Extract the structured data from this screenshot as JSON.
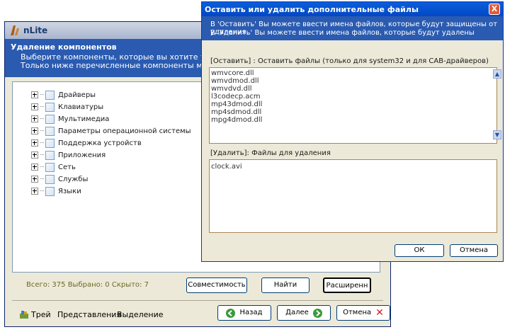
{
  "app": {
    "title": "nLite",
    "header_title": "Удаление компонентов",
    "header_line1": "Выберите компоненты, которые вы хотите удалить из у",
    "header_line2": "Только ниже перечисленные компоненты могут быть у"
  },
  "tree": {
    "items": [
      {
        "label": "Драйверы"
      },
      {
        "label": "Клавиатуры"
      },
      {
        "label": "Мультимедиа"
      },
      {
        "label": "Параметры операционной системы"
      },
      {
        "label": "Поддержка устройств"
      },
      {
        "label": "Приложения"
      },
      {
        "label": "Сеть"
      },
      {
        "label": "Службы"
      },
      {
        "label": "Языки"
      }
    ]
  },
  "status": {
    "text": "Всего: 375 Выбрано: 0 Скрыто: 7"
  },
  "buttons": {
    "compat": "Совместимость",
    "find": "Найти",
    "advanced": "Расширенн",
    "back": "Назад",
    "next": "Далее",
    "cancel": "Отмена"
  },
  "bottom_links": {
    "tray": "Трей",
    "views": "Представления",
    "selection": "Выделение"
  },
  "dialog": {
    "title": "Оставить или удалить дополнительные файлы",
    "header_line1": "В 'Оставить' Вы можете ввести имена файлов, которые будут защищены от удаления.",
    "header_line2": "В 'Удалить' Вы можете ввести имена файлов, которые будут удалены",
    "keep_label": "[Оставить] : Оставить файлы (только для system32 и для CAB-драйверов)",
    "keep_files": [
      "wmvcore.dll",
      "wmvdmod.dll",
      "wmvdvd.dll",
      "l3codecp.acm",
      "mp43dmod.dll",
      "mp4sdmod.dll",
      "mpg4dmod.dll"
    ],
    "delete_label": "[Удалить]: Файлы для удаления",
    "delete_files": [
      "clock.avi"
    ],
    "ok": "ОК",
    "cancel": "Отмена",
    "close_glyph": "X"
  },
  "colors": {
    "header_blue": "#2a5bb1",
    "titlebar_blue": "#0347c6",
    "dialog_bg": "#ece9d8"
  }
}
